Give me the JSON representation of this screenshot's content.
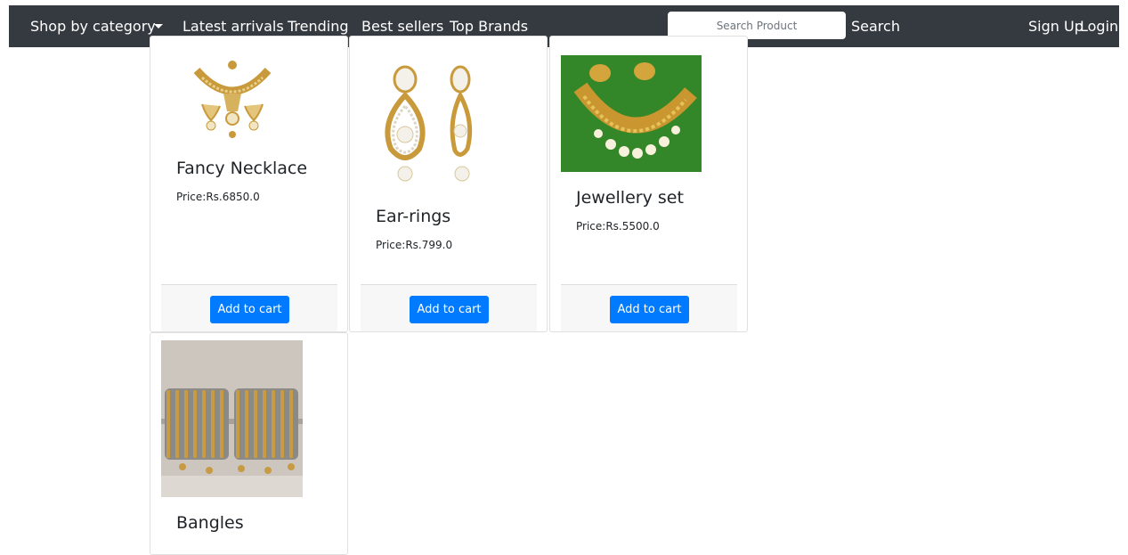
{
  "navbar": {
    "category": "Shop by category",
    "latest": "Latest arrivals",
    "trending": "Trending",
    "best": "Best sellers",
    "brands": "Top Brands",
    "search_placeholder": "Search Product",
    "search_label": "Search",
    "signup": "Sign Up",
    "login": "Login"
  },
  "products": [
    {
      "name": "Fancy Necklace",
      "price": "Price:Rs.6850.0",
      "button": "Add to cart"
    },
    {
      "name": "Ear-rings",
      "price": "Price:Rs.799.0",
      "button": "Add to cart"
    },
    {
      "name": "Jewellery set",
      "price": "Price:Rs.5500.0",
      "button": "Add to cart"
    },
    {
      "name": "Bangles"
    }
  ],
  "colors": {
    "navbar": "#343a40",
    "primary": "#007bff",
    "footer": "#f7f7f7",
    "gold": "#c99a3b",
    "green": "#2f7d25"
  }
}
